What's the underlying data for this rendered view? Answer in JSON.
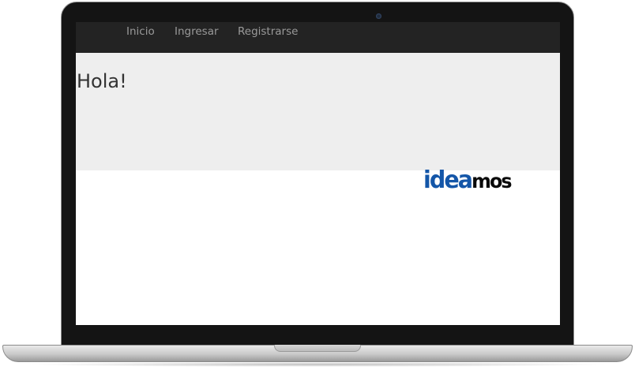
{
  "nav": {
    "items": [
      {
        "label": "Inicio"
      },
      {
        "label": "Ingresar"
      },
      {
        "label": "Registrarse"
      }
    ]
  },
  "hero": {
    "title": "Hola!"
  },
  "logo": {
    "part1": "idea",
    "part2": "mos",
    "colors": {
      "part1": "#1456a8",
      "part2": "#0a0a0a"
    }
  },
  "device": {
    "type": "laptop-mockup",
    "camera_icon": "camera-icon"
  }
}
